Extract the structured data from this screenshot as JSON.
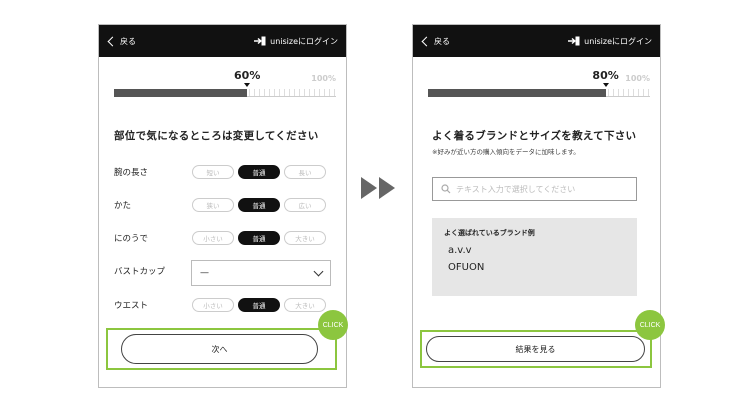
{
  "screen_left": {
    "header": {
      "back_label": "戻る",
      "login_label": "unisizeにログイン"
    },
    "progress": {
      "value_label": "60%",
      "value": 60,
      "max_label": "100%"
    },
    "heading": "部位で気になるところは変更してください",
    "rows": [
      {
        "label": "腕の長さ",
        "options": [
          "短い",
          "普通",
          "長い"
        ],
        "selected": 1
      },
      {
        "label": "かた",
        "options": [
          "狭い",
          "普通",
          "広い"
        ],
        "selected": 1
      },
      {
        "label": "にのうで",
        "options": [
          "小さい",
          "普通",
          "大きい"
        ],
        "selected": 1
      },
      {
        "label": "ウエスト",
        "options": [
          "小さい",
          "普通",
          "大きい"
        ],
        "selected": 1
      }
    ],
    "bust": {
      "label": "バストカップ",
      "value": "—"
    },
    "cta_label": "次へ",
    "click_badge": "CLICK"
  },
  "screen_right": {
    "header": {
      "back_label": "戻る",
      "login_label": "unisizeにログイン"
    },
    "progress": {
      "value_label": "80%",
      "value": 80,
      "max_label": "100%"
    },
    "heading": "よく着るブランドとサイズを教えて下さい",
    "subnote": "※好みが近い方の購入傾向をデータに加味します。",
    "search": {
      "placeholder": "テキスト入力で選択してください",
      "value": ""
    },
    "brands": {
      "title": "よく選ばれているブランド例",
      "items": [
        "a.v.v",
        "OFUON"
      ]
    },
    "cta_label": "結果を見る",
    "click_badge": "CLICK"
  },
  "colors": {
    "accent": "#8cc63f",
    "header_bg": "#111111",
    "selected_pill": "#111111"
  },
  "icons": {
    "back": "chevron-left-icon",
    "login": "login-icon",
    "search": "search-icon",
    "dropdown": "chevron-down-icon",
    "transition": "double-arrow-right-icon"
  }
}
